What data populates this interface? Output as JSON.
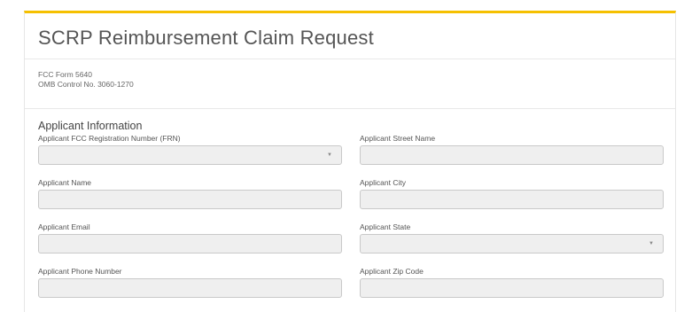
{
  "form": {
    "title": "SCRP Reimbursement Claim Request",
    "form_number": "FCC Form 5640",
    "omb_control": "OMB Control No. 3060-1270",
    "accent_color": "#f5c000"
  },
  "applicant_section": {
    "heading": "Applicant Information",
    "fields": [
      {
        "label": "Applicant FCC Registration Number (FRN)",
        "type": "select",
        "value": ""
      },
      {
        "label": "Applicant Street Name",
        "type": "text",
        "value": ""
      },
      {
        "label": "Applicant Name",
        "type": "text",
        "value": ""
      },
      {
        "label": "Applicant City",
        "type": "text",
        "value": ""
      },
      {
        "label": "Applicant Email",
        "type": "text",
        "value": ""
      },
      {
        "label": "Applicant State",
        "type": "select",
        "value": ""
      },
      {
        "label": "Applicant Phone Number",
        "type": "text",
        "value": ""
      },
      {
        "label": "Applicant Zip Code",
        "type": "text",
        "value": ""
      }
    ]
  },
  "icons": {
    "select_caret": "▼"
  }
}
